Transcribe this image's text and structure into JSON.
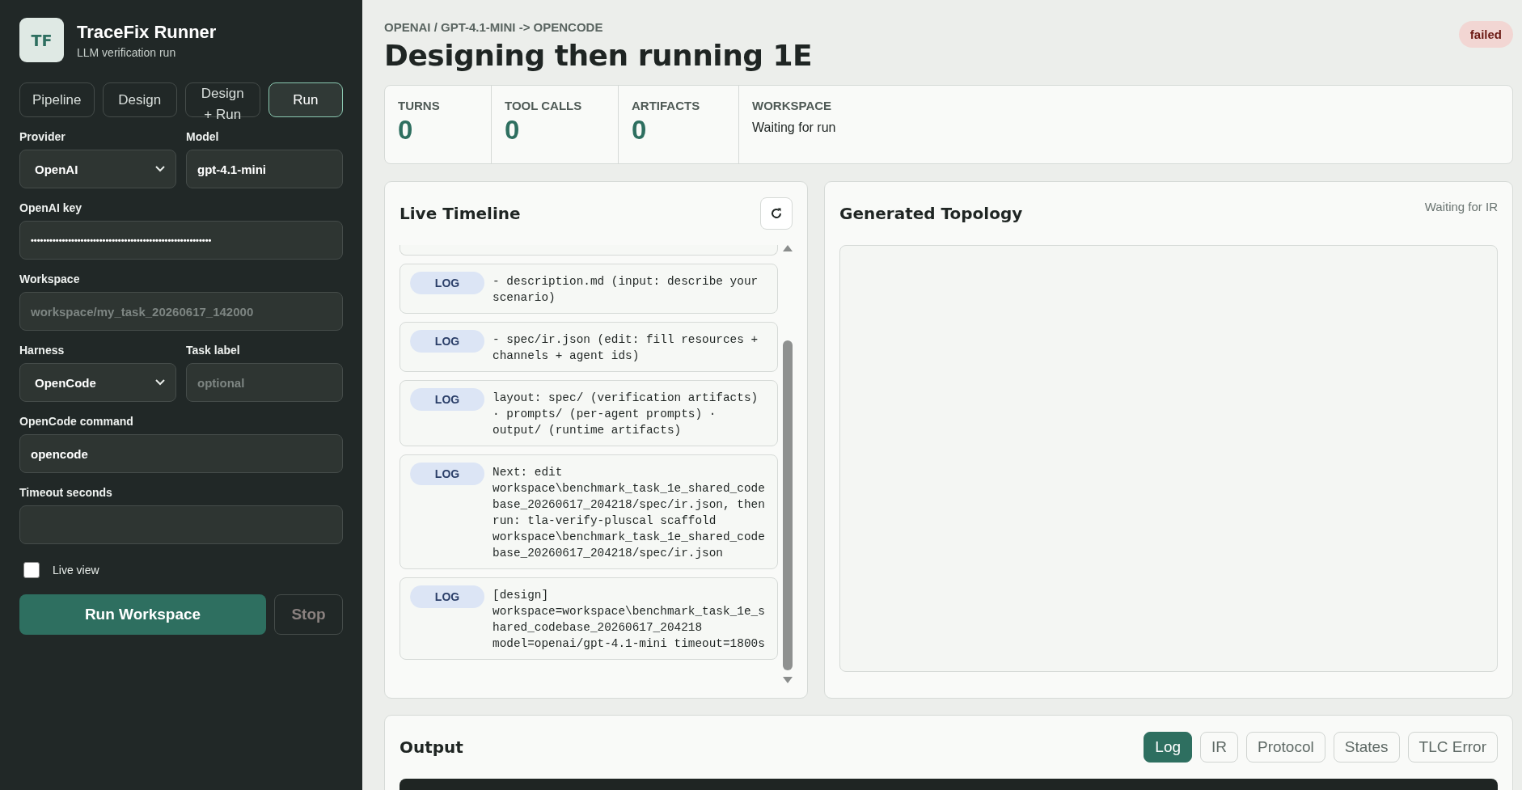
{
  "brand": {
    "logo": "TF",
    "title": "TraceFix Runner",
    "subtitle": "LLM verification run"
  },
  "mode_tabs": [
    {
      "label": "Pipeline",
      "selected": false
    },
    {
      "label": "Design",
      "selected": false
    },
    {
      "label": "Design + Run",
      "selected": false
    },
    {
      "label": "Run",
      "selected": true
    }
  ],
  "form": {
    "provider": {
      "label": "Provider",
      "value": "OpenAI"
    },
    "model": {
      "label": "Model",
      "value": "gpt-4.1-mini"
    },
    "key": {
      "label": "OpenAI key",
      "value": "••••••••••••••••••••••••••••••••••••••••••••••••••••••••••"
    },
    "workspace": {
      "label": "Workspace",
      "placeholder": "workspace/my_task_20260617_142000"
    },
    "harness": {
      "label": "Harness",
      "value": "OpenCode"
    },
    "task_label": {
      "label": "Task label",
      "placeholder": "optional"
    },
    "command": {
      "label": "OpenCode command",
      "value": "opencode"
    },
    "timeout": {
      "label": "Timeout seconds"
    },
    "live_view": {
      "label": "Live view",
      "checked": false
    }
  },
  "actions": {
    "run": "Run Workspace",
    "stop": "Stop"
  },
  "header": {
    "breadcrumb": "OPENAI / GPT-4.1-MINI -> OPENCODE",
    "title": "Designing then running 1E",
    "status": "failed"
  },
  "stats": [
    {
      "label": "TURNS",
      "value": "0"
    },
    {
      "label": "TOOL CALLS",
      "value": "0"
    },
    {
      "label": "ARTIFACTS",
      "value": "0"
    }
  ],
  "workspace_stat": {
    "label": "WORKSPACE",
    "value": "Waiting for run"
  },
  "timeline": {
    "title": "Live Timeline",
    "entries": [
      {
        "tag": "LOG",
        "text": "- description.md (input: describe your scenario)"
      },
      {
        "tag": "LOG",
        "text": "- spec/ir.json (edit: fill resources + channels + agent ids)"
      },
      {
        "tag": "LOG",
        "text": "layout: spec/ (verification artifacts) · prompts/ (per-agent prompts) · output/ (runtime artifacts)"
      },
      {
        "tag": "LOG",
        "text": "Next: edit workspace\\benchmark_task_1e_shared_codebase_20260617_204218/spec/ir.json, then run: tla-verify-pluscal scaffold workspace\\benchmark_task_1e_shared_codebase_20260617_204218/spec/ir.json"
      },
      {
        "tag": "LOG",
        "text": "[design] workspace=workspace\\benchmark_task_1e_shared_codebase_20260617_204218 model=openai/gpt-4.1-mini timeout=1800s"
      }
    ]
  },
  "topology": {
    "title": "Generated Topology",
    "status": "Waiting for IR"
  },
  "output": {
    "title": "Output",
    "tabs": [
      {
        "label": "Log",
        "selected": true
      },
      {
        "label": "IR",
        "selected": false
      },
      {
        "label": "Protocol",
        "selected": false
      },
      {
        "label": "States",
        "selected": false
      },
      {
        "label": "TLC Error",
        "selected": false
      }
    ]
  }
}
